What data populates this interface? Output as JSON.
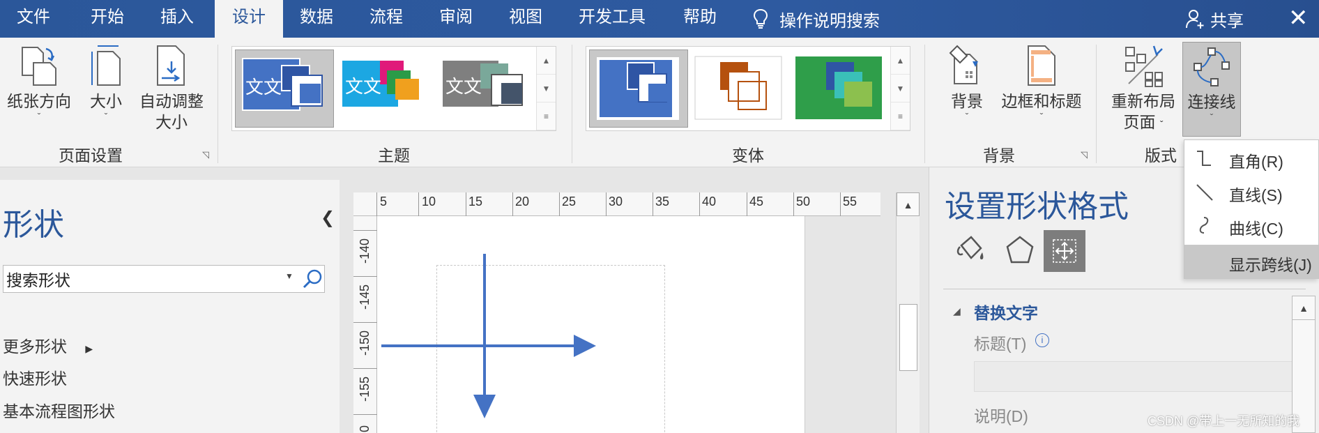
{
  "colors": {
    "accent": "#2b579a",
    "shape_blue": "#4472c4"
  },
  "menubar": {
    "tabs": [
      {
        "label": "文件"
      },
      {
        "label": "开始"
      },
      {
        "label": "插入"
      },
      {
        "label": "设计",
        "active": true
      },
      {
        "label": "数据"
      },
      {
        "label": "流程"
      },
      {
        "label": "审阅"
      },
      {
        "label": "视图"
      },
      {
        "label": "开发工具"
      },
      {
        "label": "帮助"
      }
    ],
    "search_label": "操作说明搜索",
    "search_icon": "lightbulb-icon",
    "share_label": "共享",
    "share_icon": "person-add-icon",
    "close_label": "✕"
  },
  "ribbon": {
    "page_setup": {
      "orientation": "纸张方向",
      "size": "大小",
      "auto_size_1": "自动调整",
      "auto_size_2": "大小",
      "group_label": "页面设置"
    },
    "themes": {
      "group_label": "主题",
      "tile_text": "文文"
    },
    "variants": {
      "group_label": "变体"
    },
    "background": {
      "background": "背景",
      "borders_titles": "边框和标题",
      "group_label": "背景"
    },
    "layout": {
      "relayout_1": "重新布局",
      "relayout_2": "页面",
      "connectors": "连接线",
      "group_label": "版式"
    }
  },
  "connectors_menu": {
    "items": [
      {
        "label": "直角(R)",
        "icon": "right-angle-connector-icon"
      },
      {
        "label": "直线(S)",
        "icon": "straight-connector-icon"
      },
      {
        "label": "曲线(C)",
        "icon": "curved-connector-icon"
      },
      {
        "label": "显示跨线(J)",
        "highlighted": true
      }
    ]
  },
  "shapes_pane": {
    "title": "形状",
    "search_value": "搜索形状",
    "links": [
      "更多形状",
      "快速形状",
      "基本流程图形状"
    ]
  },
  "canvas": {
    "h_ruler": [
      "5",
      "10",
      "15",
      "20",
      "25",
      "30",
      "35",
      "40",
      "45",
      "50",
      "55"
    ],
    "v_ruler": [
      "-140",
      "-145",
      "-150",
      "-155",
      "0"
    ]
  },
  "format_pane": {
    "title": "设置形状格式",
    "section": "替换文字",
    "title_label": "标题(T)",
    "desc_label": "说明(D)"
  },
  "watermark": "CSDN @带上一无所知的我"
}
